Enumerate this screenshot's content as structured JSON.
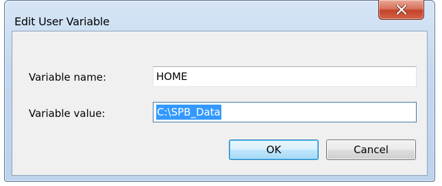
{
  "window": {
    "title": "Edit User Variable"
  },
  "icons": {
    "close": "close-icon"
  },
  "form": {
    "name_label": "Variable name:",
    "name_value": "HOME",
    "value_label": "Variable value:",
    "value_value": "C:\\SPB_Data"
  },
  "buttons": {
    "ok": "OK",
    "cancel": "Cancel"
  },
  "colors": {
    "titlebar": "#c3d8ef",
    "close_button": "#c2432a",
    "selection": "#3399ff",
    "default_button_border": "#3c7fb1"
  }
}
